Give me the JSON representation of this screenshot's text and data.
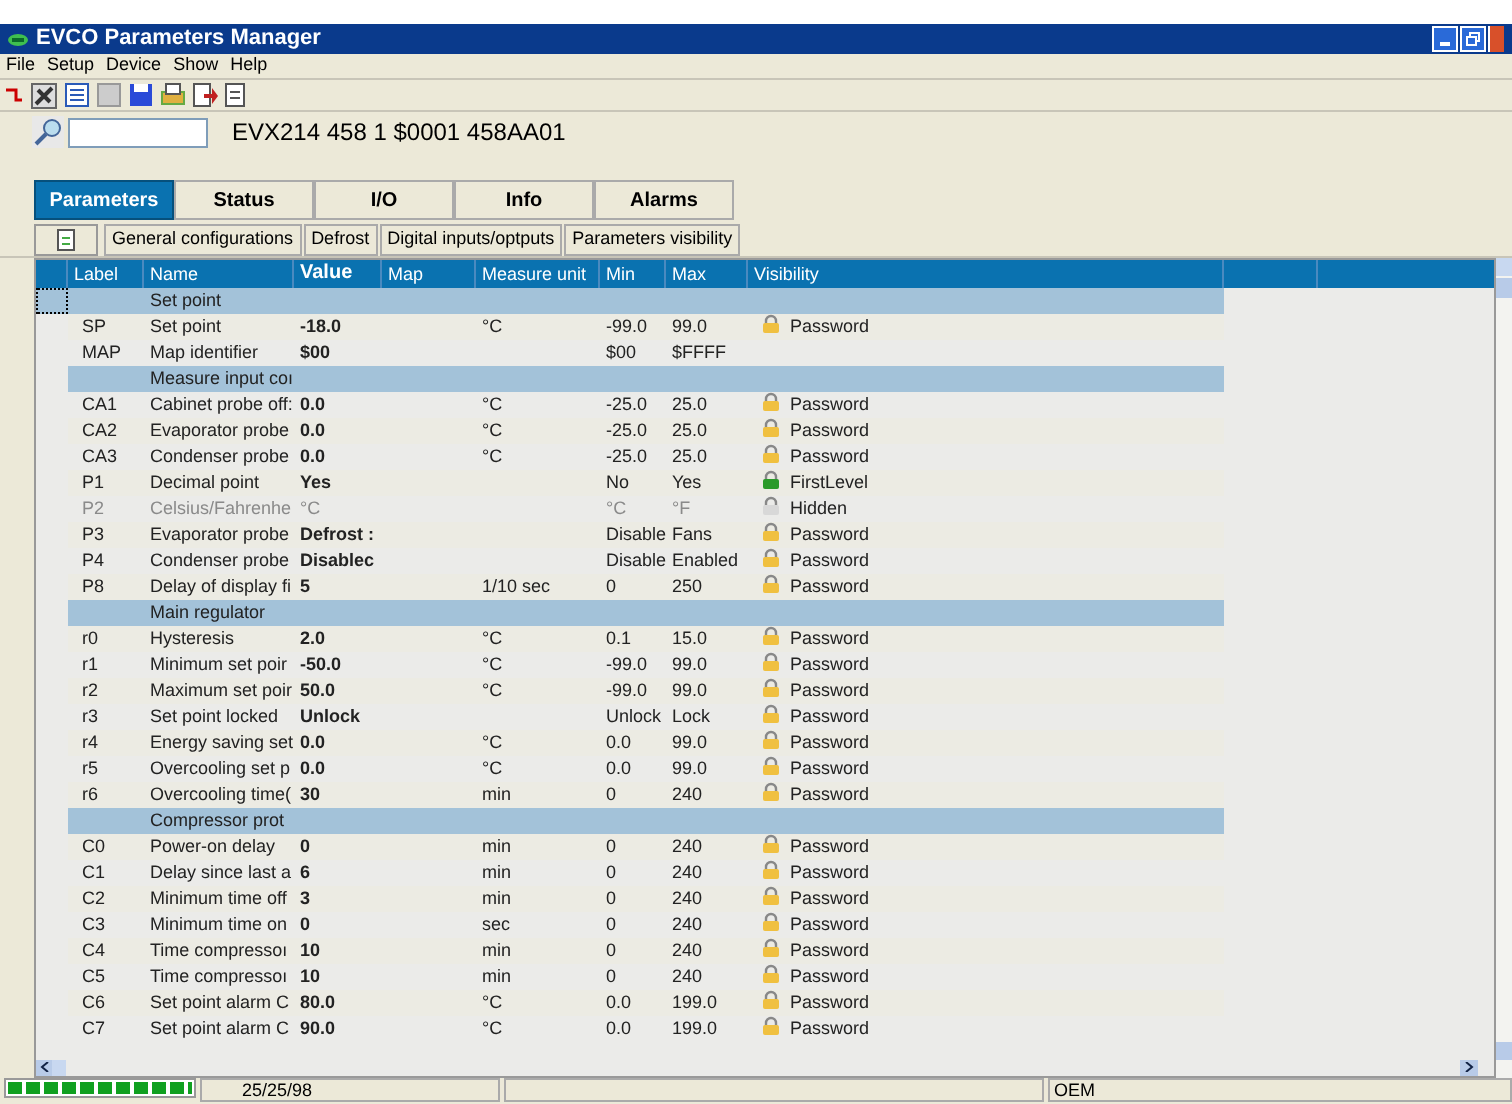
{
  "window": {
    "title": "EVCO Parameters Manager"
  },
  "menu": [
    "File",
    "Setup",
    "Device",
    "Show",
    "Help"
  ],
  "device_id": "EVX214 458 1 $0001 458AA01",
  "tabs": [
    {
      "label": "Parameters",
      "selected": true
    },
    {
      "label": "Status",
      "selected": false
    },
    {
      "label": "I/O",
      "selected": false
    },
    {
      "label": "Info",
      "selected": false
    },
    {
      "label": "Alarms",
      "selected": false
    }
  ],
  "subtabs": [
    "General configurations",
    "Defrost",
    "Digital inputs/optputs",
    "Parameters visibility"
  ],
  "table": {
    "columns": [
      "Label",
      "Name",
      "Value",
      "Map",
      "Measure unit",
      "Min",
      "Max",
      "Visibility"
    ],
    "rows": [
      {
        "kind": "group",
        "name": "Set point"
      },
      {
        "kind": "param",
        "label": "SP",
        "name": "Set point",
        "value": "-18.0",
        "unit": "°C",
        "min": "-99.0",
        "max": "99.0",
        "visibility": "Password",
        "color": "#f0c040",
        "disabled": false
      },
      {
        "kind": "param",
        "label": "MAP",
        "name": "Map identifier",
        "value": "$00",
        "min": "$00",
        "max": "$FFFF",
        "disabled": false
      },
      {
        "kind": "group",
        "name": "Measure input coı"
      },
      {
        "kind": "param",
        "label": "CA1",
        "name": "Cabinet probe off:",
        "value": "0.0",
        "unit": "°C",
        "min": "-25.0",
        "max": "25.0",
        "visibility": "Password",
        "color": "#f0c040",
        "disabled": false
      },
      {
        "kind": "param",
        "label": "CA2",
        "name": "Evaporator probe",
        "value": "0.0",
        "unit": "°C",
        "min": "-25.0",
        "max": "25.0",
        "visibility": "Password",
        "color": "#f0c040",
        "disabled": false
      },
      {
        "kind": "param",
        "label": "CA3",
        "name": "Condenser probe",
        "value": "0.0",
        "unit": "°C",
        "min": "-25.0",
        "max": "25.0",
        "visibility": "Password",
        "color": "#f0c040",
        "disabled": false
      },
      {
        "kind": "param",
        "label": "P1",
        "name": "Decimal point",
        "value": "Yes",
        "min": "No",
        "max": "Yes",
        "visibility": "FirstLevel",
        "color": "#2a9a2a",
        "disabled": false
      },
      {
        "kind": "param",
        "label": "P2",
        "name": "Celsius/Fahrenhe",
        "value": "°C",
        "min": "°C",
        "max": "°F",
        "visibility": "Hidden",
        "color": "#d8d8d8",
        "disabled": true
      },
      {
        "kind": "param",
        "label": "P3",
        "name": "Evaporator probe",
        "value": "Defrost :",
        "min": "Disable",
        "max": "Fans",
        "visibility": "Password",
        "color": "#f0c040",
        "disabled": false
      },
      {
        "kind": "param",
        "label": "P4",
        "name": "Condenser probe",
        "value": "Disablec",
        "min": "Disable",
        "max": "Enabled",
        "visibility": "Password",
        "color": "#f0c040",
        "disabled": false
      },
      {
        "kind": "param",
        "label": "P8",
        "name": "Delay of display fi",
        "value": "5",
        "unit": "1/10 sec",
        "min": "0",
        "max": "250",
        "visibility": "Password",
        "color": "#f0c040",
        "disabled": false
      },
      {
        "kind": "group",
        "name": "Main regulator"
      },
      {
        "kind": "param",
        "label": "r0",
        "name": "Hysteresis",
        "value": "2.0",
        "unit": "°C",
        "min": "0.1",
        "max": "15.0",
        "visibility": "Password",
        "color": "#f0c040",
        "disabled": false
      },
      {
        "kind": "param",
        "label": "r1",
        "name": "Minimum set poir",
        "value": "-50.0",
        "unit": "°C",
        "min": "-99.0",
        "max": "99.0",
        "visibility": "Password",
        "color": "#f0c040",
        "disabled": false
      },
      {
        "kind": "param",
        "label": "r2",
        "name": "Maximum set poir",
        "value": "50.0",
        "unit": "°C",
        "min": "-99.0",
        "max": "99.0",
        "visibility": "Password",
        "color": "#f0c040",
        "disabled": false
      },
      {
        "kind": "param",
        "label": "r3",
        "name": "Set point locked",
        "value": "Unlock",
        "min": "Unlock",
        "max": "Lock",
        "visibility": "Password",
        "color": "#f0c040",
        "disabled": false
      },
      {
        "kind": "param",
        "label": "r4",
        "name": "Energy saving set",
        "value": "0.0",
        "unit": "°C",
        "min": "0.0",
        "max": "99.0",
        "visibility": "Password",
        "color": "#f0c040",
        "disabled": false
      },
      {
        "kind": "param",
        "label": "r5",
        "name": "Overcooling set p",
        "value": "0.0",
        "unit": "°C",
        "min": "0.0",
        "max": "99.0",
        "visibility": "Password",
        "color": "#f0c040",
        "disabled": false
      },
      {
        "kind": "param",
        "label": "r6",
        "name": "Overcooling time(",
        "value": "30",
        "unit": "min",
        "min": "0",
        "max": "240",
        "visibility": "Password",
        "color": "#f0c040",
        "disabled": false
      },
      {
        "kind": "group",
        "name": "Compressor prot"
      },
      {
        "kind": "param",
        "label": "C0",
        "name": "Power-on delay",
        "value": "0",
        "unit": "min",
        "min": "0",
        "max": "240",
        "visibility": "Password",
        "color": "#f0c040",
        "disabled": false
      },
      {
        "kind": "param",
        "label": "C1",
        "name": "Delay since last a",
        "value": "6",
        "unit": "min",
        "min": "0",
        "max": "240",
        "visibility": "Password",
        "color": "#f0c040",
        "disabled": false
      },
      {
        "kind": "param",
        "label": "C2",
        "name": "Minimum time off",
        "value": "3",
        "unit": "min",
        "min": "0",
        "max": "240",
        "visibility": "Password",
        "color": "#f0c040",
        "disabled": false
      },
      {
        "kind": "param",
        "label": "C3",
        "name": "Minimum time on",
        "value": "0",
        "unit": "sec",
        "min": "0",
        "max": "240",
        "visibility": "Password",
        "color": "#f0c040",
        "disabled": false
      },
      {
        "kind": "param",
        "label": "C4",
        "name": "Time compressoı",
        "value": "10",
        "unit": "min",
        "min": "0",
        "max": "240",
        "visibility": "Password",
        "color": "#f0c040",
        "disabled": false
      },
      {
        "kind": "param",
        "label": "C5",
        "name": "Time compressoı",
        "value": "10",
        "unit": "min",
        "min": "0",
        "max": "240",
        "visibility": "Password",
        "color": "#f0c040",
        "disabled": false
      },
      {
        "kind": "param",
        "label": "C6",
        "name": "Set point alarm C",
        "value": "80.0",
        "unit": "°C",
        "min": "0.0",
        "max": "199.0",
        "visibility": "Password",
        "color": "#f0c040",
        "disabled": false
      },
      {
        "kind": "param",
        "label": "C7",
        "name": "Set point alarm C",
        "value": "90.0",
        "unit": "°C",
        "min": "0.0",
        "max": "199.0",
        "visibility": "Password",
        "color": "#f0c040",
        "disabled": false
      }
    ]
  },
  "status_bar": {
    "progress": {
      "level": 1
    },
    "date": "25/25/98",
    "mode": "OEM"
  }
}
